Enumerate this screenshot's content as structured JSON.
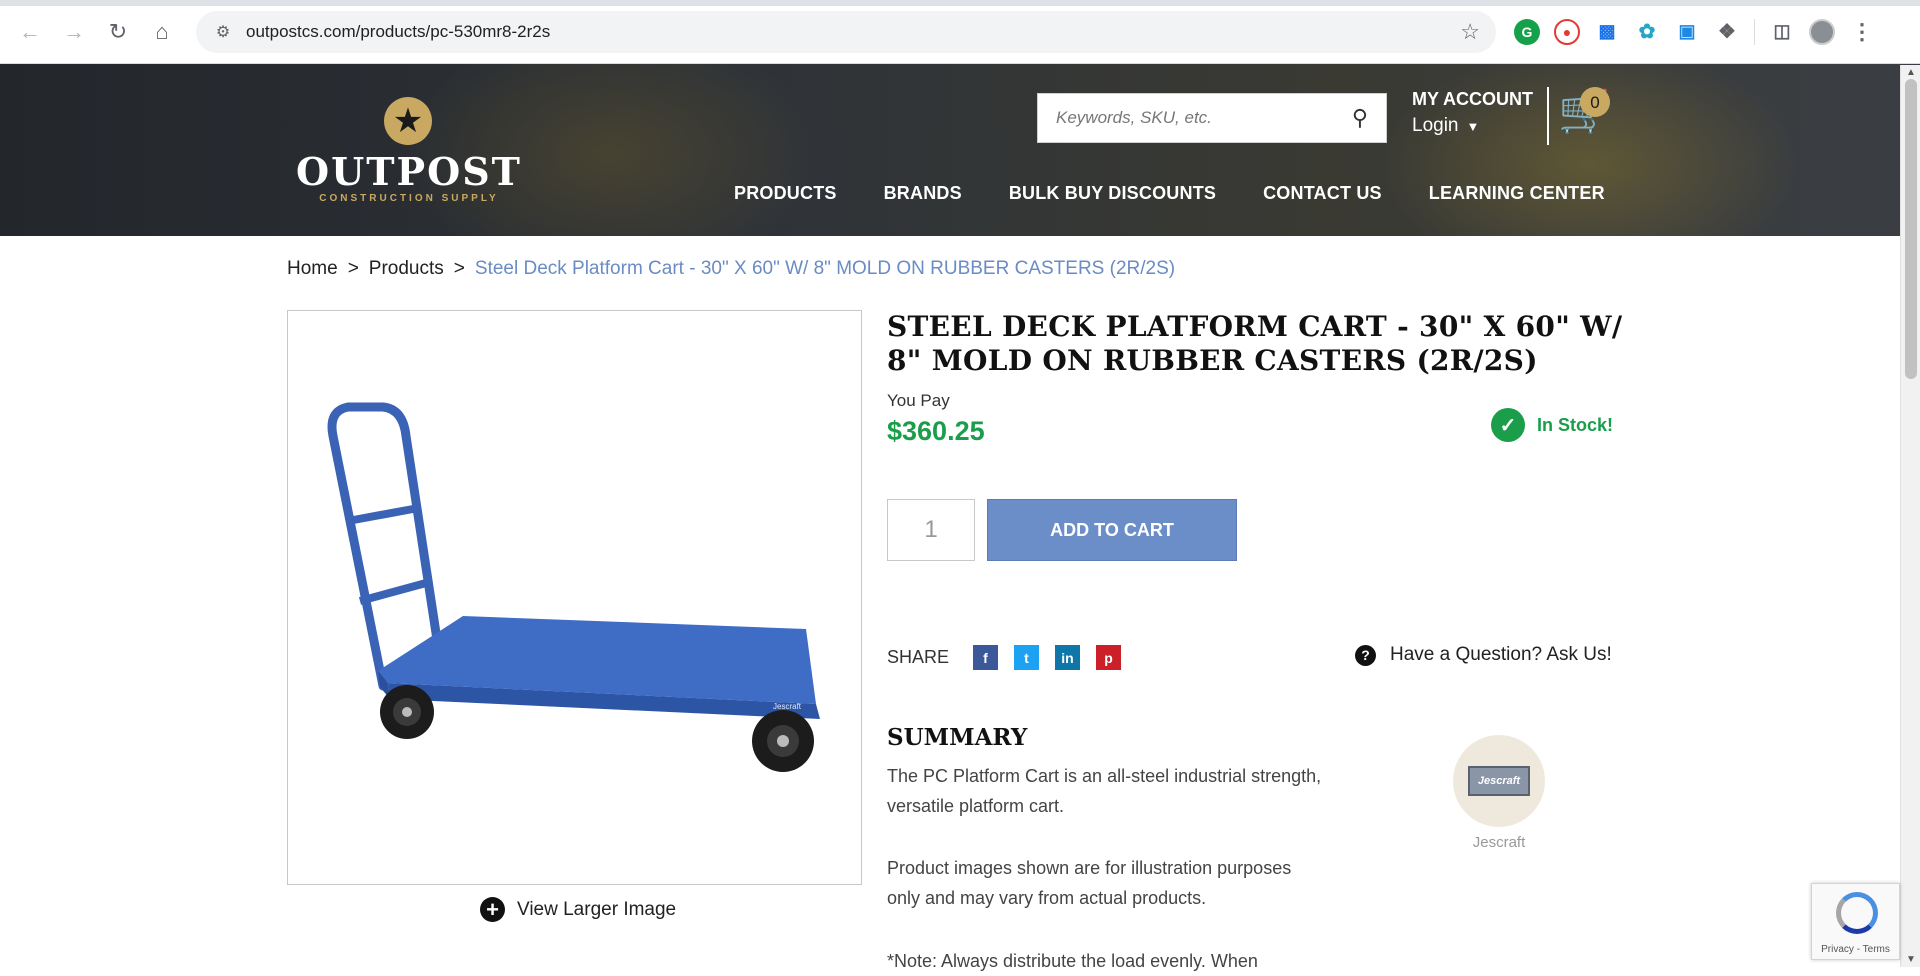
{
  "browser": {
    "url": "outpostcs.com/products/pc-530mr8-2r2s"
  },
  "header": {
    "brand": "OUTPOST",
    "tagline": "CONSTRUCTION SUPPLY",
    "search_placeholder": "Keywords, SKU, etc.",
    "account_title": "MY ACCOUNT",
    "login_label": "Login",
    "cart_count": "0",
    "nav": [
      "PRODUCTS",
      "BRANDS",
      "BULK BUY DISCOUNTS",
      "CONTACT US",
      "LEARNING CENTER"
    ]
  },
  "breadcrumb": {
    "home": "Home",
    "sep1": ">",
    "products": "Products",
    "sep2": ">",
    "current": "Steel Deck Platform Cart - 30\" X 60\" W/ 8\" MOLD ON RUBBER CASTERS (2R/2S)"
  },
  "product": {
    "title": "STEEL DECK PLATFORM CART - 30\" X 60\" W/ 8\" MOLD ON RUBBER CASTERS (2R/2S)",
    "you_pay_label": "You Pay",
    "price": "$360.25",
    "stock": "In Stock!",
    "qty": "1",
    "add_to_cart": "ADD TO CART",
    "view_larger": "View Larger Image",
    "image_brand_mark": "Jescraft"
  },
  "share": {
    "label": "SHARE",
    "networks": [
      "f",
      "t",
      "in",
      "p"
    ],
    "question": "Have a Question? Ask Us!"
  },
  "summary": {
    "heading": "SUMMARY",
    "p1": "The PC Platform Cart is an all-steel industrial strength, versatile platform cart.",
    "p2": "Product images shown are for illustration purposes only and may vary from actual products.",
    "p3": "*Note: Always distribute the load evenly. When",
    "brand_logo_text": "Jescraft",
    "brand_name": "Jescraft"
  },
  "recaptcha": {
    "text": "Privacy - Terms"
  },
  "colors": {
    "accent_gold": "#c9a961",
    "price_green": "#1a9e4a",
    "button_blue": "#6b8ec9",
    "breadcrumb_current": "#6a8bc4"
  }
}
